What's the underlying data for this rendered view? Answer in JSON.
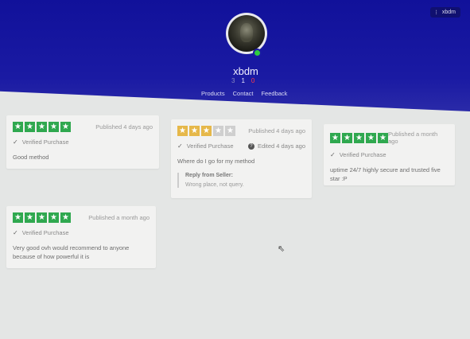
{
  "header": {
    "username": "xbdm",
    "chip_label": "xbdm",
    "chip_icon": "menu-dots-icon",
    "counts": [
      "3",
      "1",
      "0"
    ],
    "nav": [
      "Products",
      "Contact",
      "Feedback"
    ],
    "colors": {
      "banner": "#1a1aa3",
      "online": "#2ecc40",
      "star_green": "#2fa84f",
      "star_amber": "#e6b84a"
    }
  },
  "reviews": [
    {
      "stars": 5,
      "published": "Published 4 days ago",
      "verified": "Verified Purchase",
      "text": "Good method"
    },
    {
      "stars": 3,
      "published": "Published 4 days ago",
      "verified": "Verified Purchase",
      "edited": "Edited 4 days ago",
      "text": "Where do I go for my method",
      "reply_title": "Reply from Seller:",
      "reply_body": "Wrong place, not query."
    },
    {
      "stars": 5,
      "published": "Published a month ago",
      "verified": "Verified Purchase",
      "text": "uptime 24/7 highly secure and trusted five star :P"
    },
    {
      "stars": 5,
      "published": "Published a month ago",
      "verified": "Verified Purchase",
      "text": "Very good ovh would recommend to anyone because of how powerful it is"
    }
  ]
}
